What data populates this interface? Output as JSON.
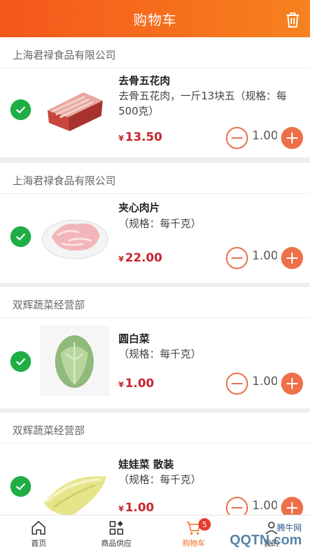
{
  "header": {
    "title": "购物车",
    "delete_icon": "trash-icon"
  },
  "colors": {
    "accent": "#f5571b",
    "price": "#c8232c",
    "check": "#1fae46"
  },
  "items": [
    {
      "store": "上海君禄食品有限公司",
      "name": "去骨五花肉",
      "desc": "去骨五花肉，一斤13块五（规格：每500克）",
      "currency": "¥",
      "price": "13.50",
      "qty": "1.00",
      "checked": true,
      "image": "pork-belly"
    },
    {
      "store": "上海君禄食品有限公司",
      "name": "夹心肉片",
      "desc": "（规格：每千克）",
      "currency": "¥",
      "price": "22.00",
      "qty": "1.00",
      "checked": true,
      "image": "sliced-pork"
    },
    {
      "store": "双辉蔬菜经营部",
      "name": "圆白菜",
      "desc": "（规格：每千克）",
      "currency": "¥",
      "price": "1.00",
      "qty": "1.00",
      "checked": true,
      "image": "cabbage"
    },
    {
      "store": "双辉蔬菜经营部",
      "name": "娃娃菜 散装",
      "desc": "（规格：每千克）",
      "currency": "¥",
      "price": "1.00",
      "qty": "1.00",
      "checked": true,
      "image": "baby-cabbage"
    }
  ],
  "tabbar": {
    "tabs": [
      {
        "label": "首页",
        "icon": "home-icon"
      },
      {
        "label": "商品供应",
        "icon": "grid-icon"
      },
      {
        "label": "购物车",
        "icon": "cart-icon",
        "badge": "5",
        "active": true
      },
      {
        "label": "我的",
        "icon": "user-icon"
      }
    ]
  },
  "watermark": {
    "text_cn": "腾牛网",
    "text_logo": "QQTN.com"
  }
}
